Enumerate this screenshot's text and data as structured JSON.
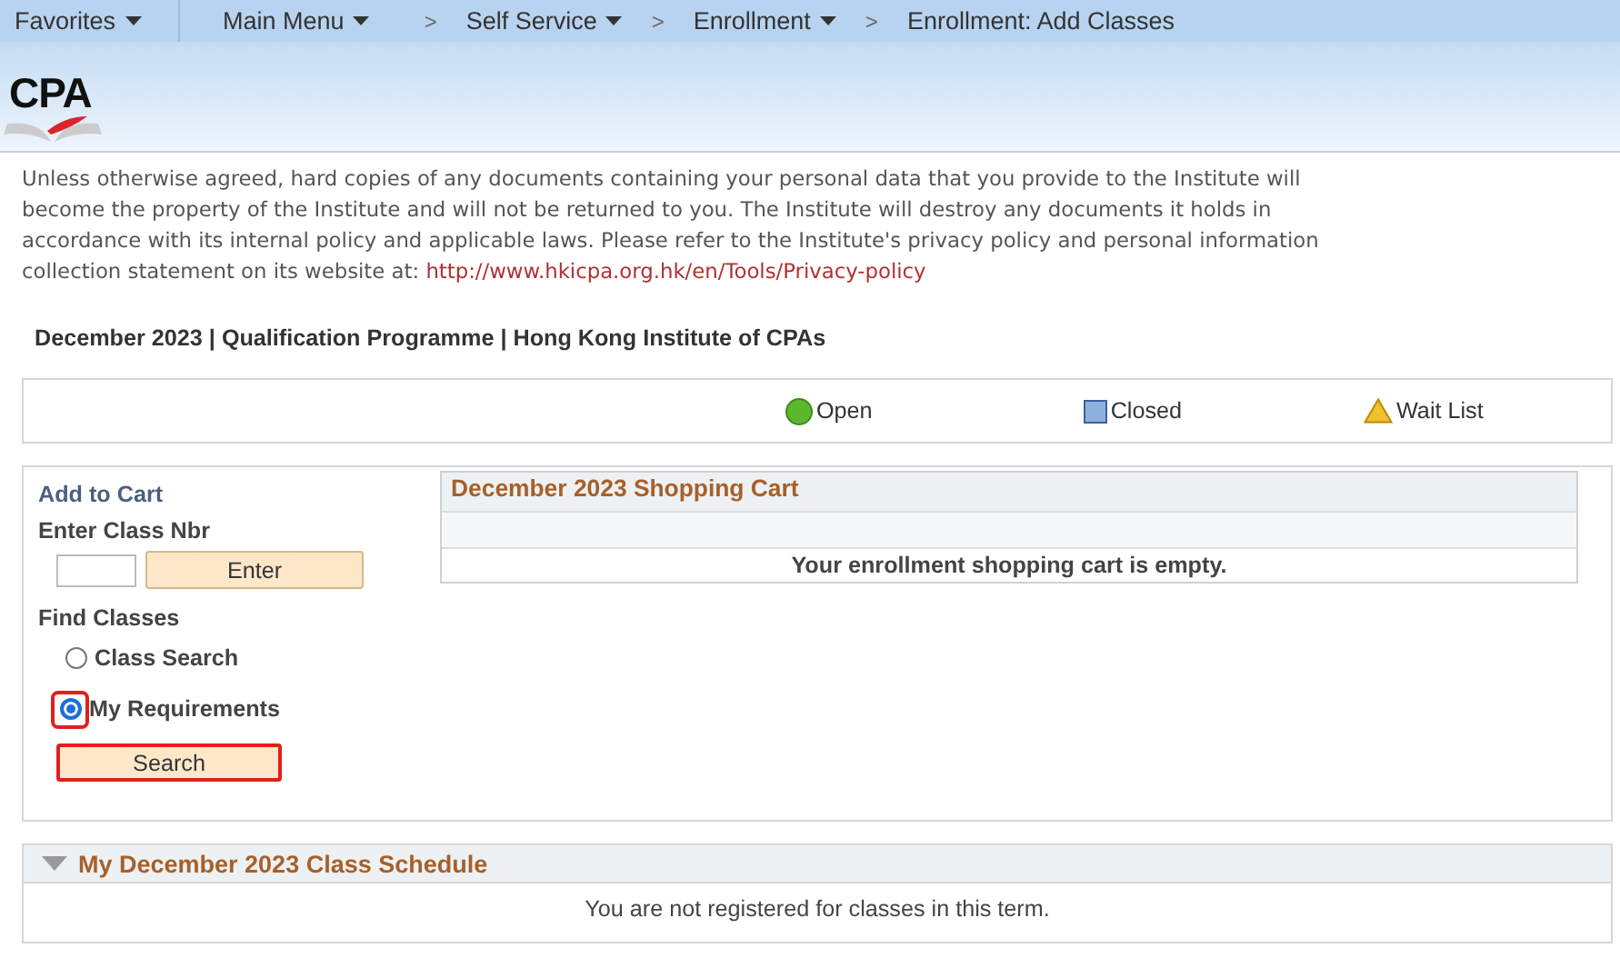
{
  "nav": {
    "items": [
      {
        "label": "Favorites",
        "kind": "menu"
      },
      {
        "label": "Main Menu",
        "kind": "menu"
      },
      {
        "label": "Self Service",
        "kind": "crumb-menu",
        "separator": ">"
      },
      {
        "label": "Enrollment",
        "kind": "crumb-menu",
        "separator": ">"
      },
      {
        "label": "Enrollment: Add Classes",
        "kind": "crumb",
        "separator": ">"
      }
    ]
  },
  "logo": {
    "text": "CPA"
  },
  "notice": {
    "text": "Unless otherwise agreed, hard copies of any documents containing your personal data that you provide to the Institute will become the property of the Institute and will not be returned to you. The Institute will destroy any documents it holds in accordance with its internal policy and applicable laws. Please refer to the Institute's privacy policy and personal information collection statement on its website at: ",
    "link": "http://www.hkicpa.org.hk/en/Tools/Privacy-policy"
  },
  "term_title": "December 2023 | Qualification Programme | Hong Kong Institute of CPAs",
  "legend": [
    {
      "label": "Open",
      "kind": "circle",
      "color": "#5cb82e"
    },
    {
      "label": "Closed",
      "kind": "square",
      "color": "#8fb1dd"
    },
    {
      "label": "Wait List",
      "kind": "triangle",
      "color": "#f2c12e"
    }
  ],
  "add_to_cart": {
    "title": "Add to Cart",
    "class_nbr_label": "Enter Class Nbr",
    "enter_button": "Enter"
  },
  "find_classes": {
    "title": "Find Classes",
    "options": [
      {
        "label": "Class Search",
        "selected": false,
        "highlighted": false
      },
      {
        "label": "My Requirements",
        "selected": true,
        "highlighted": true
      }
    ],
    "search_button": {
      "label": "Search",
      "highlighted": true
    }
  },
  "cart": {
    "title": "December 2023 Shopping Cart",
    "message": "Your enrollment shopping cart is empty."
  },
  "schedule": {
    "title": "My December 2023 Class Schedule",
    "expanded": true,
    "message": "You are not registered for classes in this term."
  }
}
